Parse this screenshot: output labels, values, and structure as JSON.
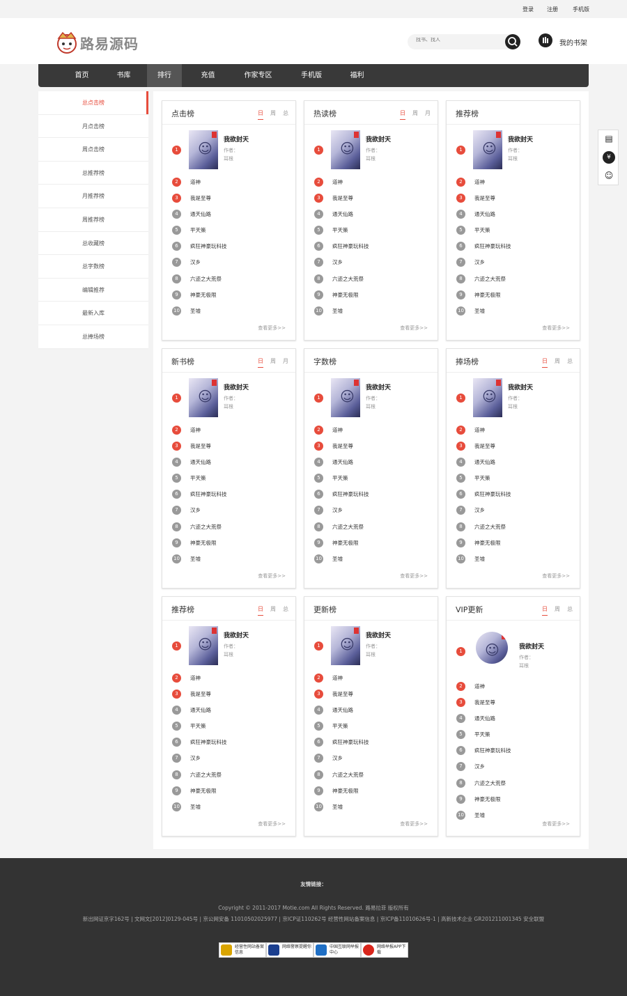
{
  "topbar": {
    "login": "登录",
    "register": "注册",
    "mobile": "手机版"
  },
  "header": {
    "logo_text": "路易源码",
    "search_placeholder": "找书、找人",
    "shelf_label": "我的书架"
  },
  "nav": [
    "首页",
    "书库",
    "排行",
    "充值",
    "作家专区",
    "手机版",
    "福利"
  ],
  "sidebar": [
    "总点击榜",
    "月点击榜",
    "周点击榜",
    "总推荐榜",
    "月推荐榜",
    "周推荐榜",
    "总收藏榜",
    "总字数榜",
    "编辑推荐",
    "最新入库",
    "总捧场榜"
  ],
  "book": {
    "name": "我欲封天",
    "author_label": "作者：",
    "author": "耳根"
  },
  "list_items": [
    "道神",
    "我是至尊",
    "通天仙路",
    "平天策",
    "疯狂神豪玩科技",
    "汉乡",
    "六迹之大荒祭",
    "神豪无极限",
    "圣墟"
  ],
  "more": "查看更多>>",
  "cards": [
    {
      "title": "点击榜",
      "tabs": [
        "日",
        "周",
        "总"
      ]
    },
    {
      "title": "热读榜",
      "tabs": [
        "日",
        "周",
        "月"
      ]
    },
    {
      "title": "推荐榜",
      "tabs": []
    },
    {
      "title": "新书榜",
      "tabs": [
        "日",
        "周",
        "月"
      ]
    },
    {
      "title": "字数榜",
      "tabs": []
    },
    {
      "title": "捧场榜",
      "tabs": [
        "日",
        "周",
        "总"
      ]
    },
    {
      "title": "推荐榜",
      "tabs": [
        "日",
        "周",
        "总"
      ]
    },
    {
      "title": "更新榜",
      "tabs": []
    },
    {
      "title": "VIP更新",
      "tabs": [
        "日",
        "周",
        "总"
      ]
    }
  ],
  "footer": {
    "friend_links": "友情链接：",
    "copyright": "Copyright © 2011-2017 Motie.com All Rights Reserved. 路易拉菲 版权所有",
    "licenses": "新出网证京字162号 | 文网文[2012]0129-045号 | 京公网安备 11010502025977 | 京ICP证110262号 经营性网站备案信息 | 京ICP备11010626号-1 | 高新技术企业 GR201211001345 安全联盟",
    "badges": [
      {
        "text": "经营性网站备案信息",
        "color": "#d9a400"
      },
      {
        "text": "网络警察提醒你",
        "color": "#1b3f8f"
      },
      {
        "text": "中国互联网举报中心",
        "color": "#1f6fc5"
      },
      {
        "text": "网络举报APP下载",
        "color": "#d9261c"
      }
    ]
  }
}
